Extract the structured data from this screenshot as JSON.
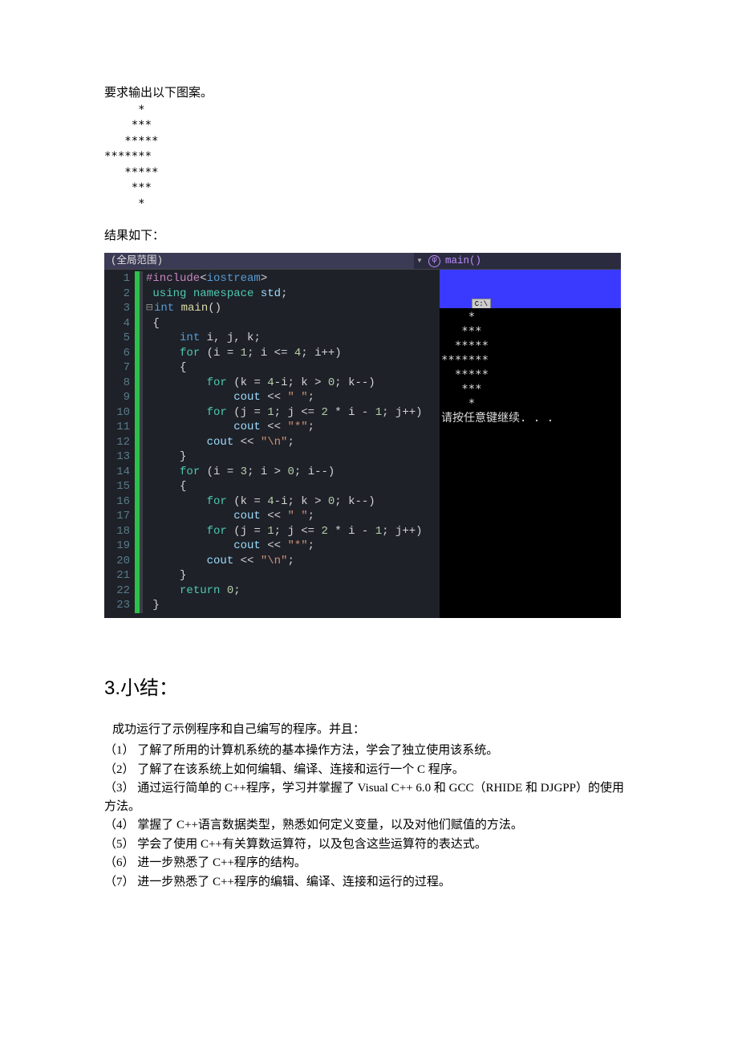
{
  "opening": "要求输出以下图案。",
  "pattern": "     *\n    ***\n   *****\n*******\n   *****\n    ***\n     *",
  "result_label": "结果如下：",
  "ide": {
    "scope_label": "(全局范围)",
    "func_label": "main()",
    "lines": [
      "1",
      "2",
      "3",
      "4",
      "5",
      "6",
      "7",
      "8",
      "9",
      "10",
      "11",
      "12",
      "13",
      "14",
      "15",
      "16",
      "17",
      "18",
      "19",
      "20",
      "21",
      "22",
      "23"
    ],
    "code_tokens": [
      [
        {
          "c": "pre",
          "t": "#include"
        },
        {
          "c": "pun",
          "t": "<"
        },
        {
          "c": "typ",
          "t": "iostream"
        },
        {
          "c": "pun",
          "t": ">"
        }
      ],
      [
        {
          "c": "pun",
          "t": " "
        },
        {
          "c": "kw",
          "t": "using"
        },
        {
          "c": "pun",
          "t": " "
        },
        {
          "c": "kw",
          "t": "namespace"
        },
        {
          "c": "pun",
          "t": " "
        },
        {
          "c": "id",
          "t": "std"
        },
        {
          "c": "pun",
          "t": ";"
        }
      ],
      [
        {
          "c": "fold",
          "t": "⊟"
        },
        {
          "c": "typ",
          "t": "int"
        },
        {
          "c": "pun",
          "t": " "
        },
        {
          "c": "fn",
          "t": "main"
        },
        {
          "c": "pun",
          "t": "()"
        }
      ],
      [
        {
          "c": "pun",
          "t": " {"
        }
      ],
      [
        {
          "c": "pun",
          "t": "     "
        },
        {
          "c": "typ",
          "t": "int"
        },
        {
          "c": "pun",
          "t": " i, j, k;"
        }
      ],
      [
        {
          "c": "pun",
          "t": "     "
        },
        {
          "c": "kw",
          "t": "for"
        },
        {
          "c": "pun",
          "t": " (i = "
        },
        {
          "c": "num",
          "t": "1"
        },
        {
          "c": "pun",
          "t": "; i <= "
        },
        {
          "c": "num",
          "t": "4"
        },
        {
          "c": "pun",
          "t": "; i++)"
        }
      ],
      [
        {
          "c": "pun",
          "t": "     {"
        }
      ],
      [
        {
          "c": "pun",
          "t": "         "
        },
        {
          "c": "kw",
          "t": "for"
        },
        {
          "c": "pun",
          "t": " (k = "
        },
        {
          "c": "num",
          "t": "4"
        },
        {
          "c": "pun",
          "t": "-i; k > "
        },
        {
          "c": "num",
          "t": "0"
        },
        {
          "c": "pun",
          "t": "; k--)"
        }
      ],
      [
        {
          "c": "pun",
          "t": "             "
        },
        {
          "c": "id",
          "t": "cout"
        },
        {
          "c": "pun",
          "t": " << "
        },
        {
          "c": "str",
          "t": "\" \""
        },
        {
          "c": "pun",
          "t": ";"
        }
      ],
      [
        {
          "c": "pun",
          "t": "         "
        },
        {
          "c": "kw",
          "t": "for"
        },
        {
          "c": "pun",
          "t": " (j = "
        },
        {
          "c": "num",
          "t": "1"
        },
        {
          "c": "pun",
          "t": "; j <= "
        },
        {
          "c": "num",
          "t": "2"
        },
        {
          "c": "pun",
          "t": " * i - "
        },
        {
          "c": "num",
          "t": "1"
        },
        {
          "c": "pun",
          "t": "; j++)"
        }
      ],
      [
        {
          "c": "pun",
          "t": "             "
        },
        {
          "c": "id",
          "t": "cout"
        },
        {
          "c": "pun",
          "t": " << "
        },
        {
          "c": "str",
          "t": "\"*\""
        },
        {
          "c": "pun",
          "t": ";"
        }
      ],
      [
        {
          "c": "pun",
          "t": "         "
        },
        {
          "c": "id",
          "t": "cout"
        },
        {
          "c": "pun",
          "t": " << "
        },
        {
          "c": "str",
          "t": "\"\\n\""
        },
        {
          "c": "pun",
          "t": ";"
        }
      ],
      [
        {
          "c": "pun",
          "t": "     }"
        }
      ],
      [
        {
          "c": "pun",
          "t": "     "
        },
        {
          "c": "kw",
          "t": "for"
        },
        {
          "c": "pun",
          "t": " (i = "
        },
        {
          "c": "num",
          "t": "3"
        },
        {
          "c": "pun",
          "t": "; i > "
        },
        {
          "c": "num",
          "t": "0"
        },
        {
          "c": "pun",
          "t": "; i--)"
        }
      ],
      [
        {
          "c": "pun",
          "t": "     {"
        }
      ],
      [
        {
          "c": "pun",
          "t": "         "
        },
        {
          "c": "kw",
          "t": "for"
        },
        {
          "c": "pun",
          "t": " (k = "
        },
        {
          "c": "num",
          "t": "4"
        },
        {
          "c": "pun",
          "t": "-i; k > "
        },
        {
          "c": "num",
          "t": "0"
        },
        {
          "c": "pun",
          "t": "; k--)"
        }
      ],
      [
        {
          "c": "pun",
          "t": "             "
        },
        {
          "c": "id",
          "t": "cout"
        },
        {
          "c": "pun",
          "t": " << "
        },
        {
          "c": "str",
          "t": "\" \""
        },
        {
          "c": "pun",
          "t": ";"
        }
      ],
      [
        {
          "c": "pun",
          "t": "         "
        },
        {
          "c": "kw",
          "t": "for"
        },
        {
          "c": "pun",
          "t": " (j = "
        },
        {
          "c": "num",
          "t": "1"
        },
        {
          "c": "pun",
          "t": "; j <= "
        },
        {
          "c": "num",
          "t": "2"
        },
        {
          "c": "pun",
          "t": " * i - "
        },
        {
          "c": "num",
          "t": "1"
        },
        {
          "c": "pun",
          "t": "; j++)"
        }
      ],
      [
        {
          "c": "pun",
          "t": "             "
        },
        {
          "c": "id",
          "t": "cout"
        },
        {
          "c": "pun",
          "t": " << "
        },
        {
          "c": "str",
          "t": "\"*\""
        },
        {
          "c": "pun",
          "t": ";"
        }
      ],
      [
        {
          "c": "pun",
          "t": "         "
        },
        {
          "c": "id",
          "t": "cout"
        },
        {
          "c": "pun",
          "t": " << "
        },
        {
          "c": "str",
          "t": "\"\\n\""
        },
        {
          "c": "pun",
          "t": ";"
        }
      ],
      [
        {
          "c": "pun",
          "t": "     }"
        }
      ],
      [
        {
          "c": "pun",
          "t": "     "
        },
        {
          "c": "kw",
          "t": "return"
        },
        {
          "c": "pun",
          "t": " "
        },
        {
          "c": "num",
          "t": "0"
        },
        {
          "c": "pun",
          "t": ";"
        }
      ],
      [
        {
          "c": "pun",
          "t": " }"
        }
      ]
    ],
    "console_title": "C:\\",
    "console_output": "    *\n   ***\n  *****\n*******\n  *****\n   ***\n    *\n请按任意键继续. . ."
  },
  "section_title": "3.小结：",
  "summary_intro": "成功运行了示例程序和自己编写的程序。并且：",
  "summary_items": [
    "（1） 了解了所用的计算机系统的基本操作方法，学会了独立使用该系统。",
    "（2） 了解了在该系统上如何编辑、编译、连接和运行一个 C 程序。",
    "（3） 通过运行简单的 C++程序，学习并掌握了 Visual C++ 6.0 和 GCC（RHIDE 和 DJGPP）的使用方法。",
    "（4） 掌握了 C++语言数据类型，熟悉如何定义变量，以及对他们赋值的方法。",
    "（5） 学会了使用 C++有关算数运算符，以及包含这些运算符的表达式。",
    "（6） 进一步熟悉了 C++程序的结构。",
    "（7） 进一步熟悉了 C++程序的编辑、编译、连接和运行的过程。"
  ]
}
